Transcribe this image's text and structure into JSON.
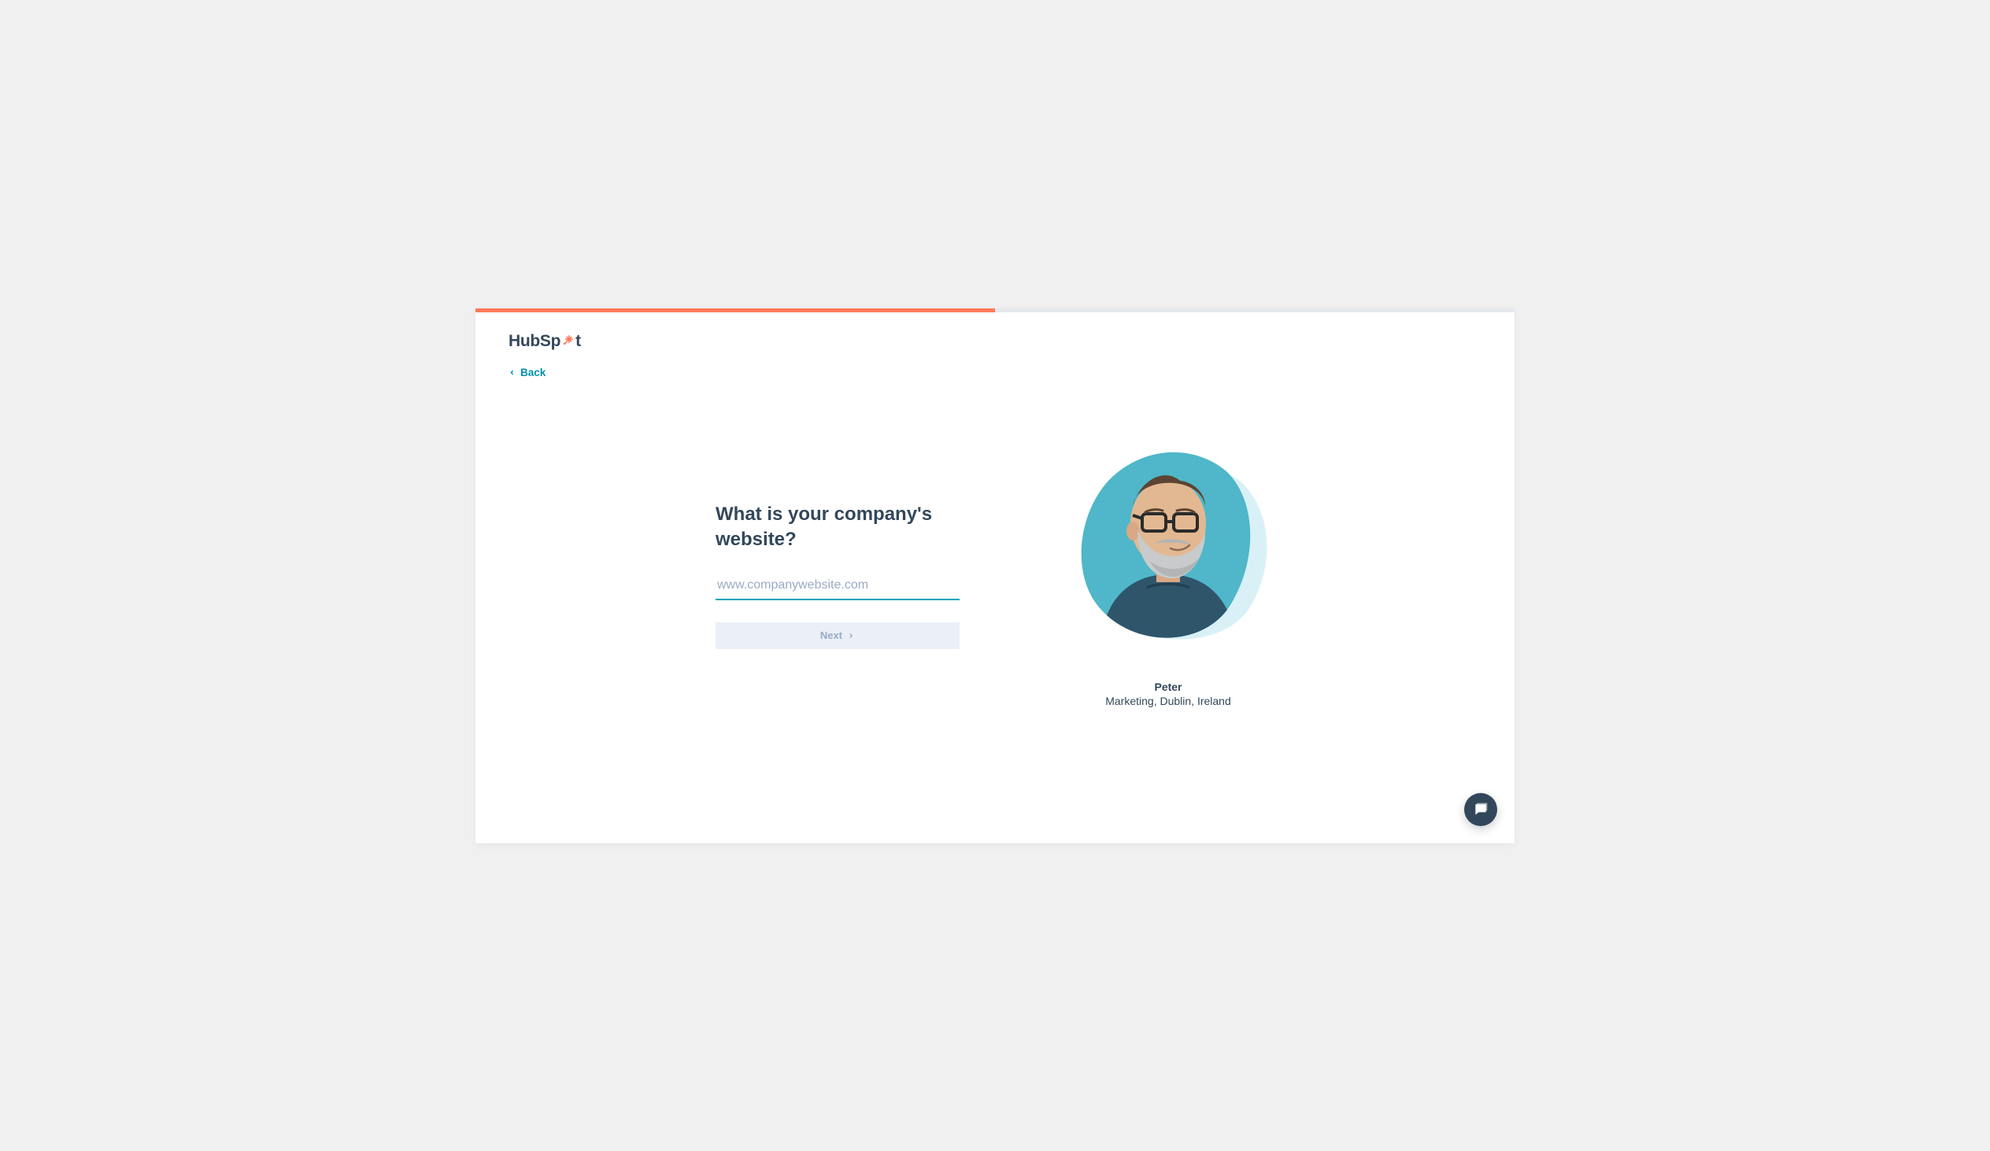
{
  "brand": {
    "name_left": "HubSp",
    "name_right": "t"
  },
  "nav": {
    "back_label": "Back"
  },
  "progress": {
    "percent": 50
  },
  "form": {
    "heading": "What is your company's website?",
    "placeholder": "www.companywebsite.com",
    "value": "",
    "next_label": "Next"
  },
  "persona": {
    "name": "Peter",
    "role": "Marketing, Dublin, Ireland"
  }
}
